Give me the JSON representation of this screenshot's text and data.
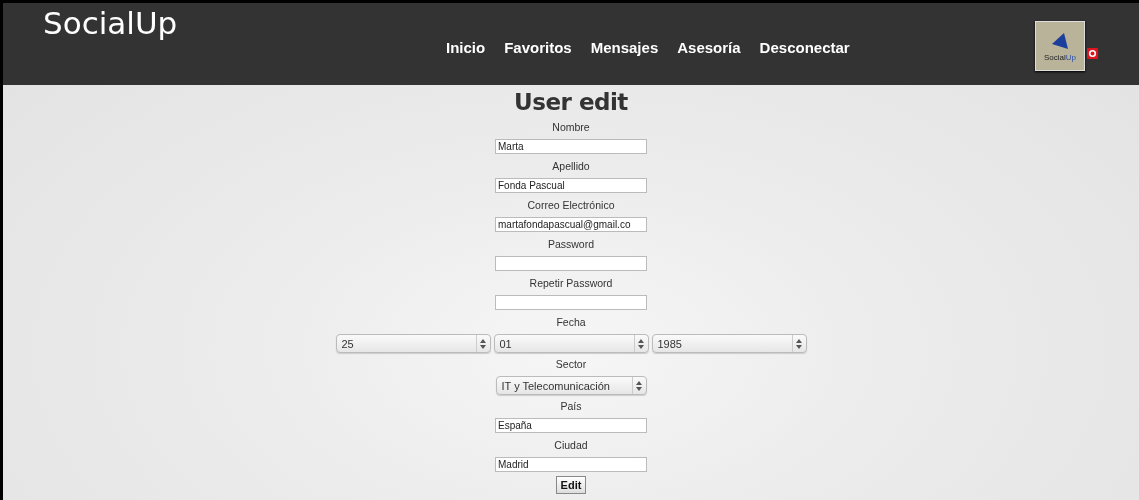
{
  "brand": "SocialUp",
  "nav": [
    {
      "label": "Inicio"
    },
    {
      "label": "Favoritos"
    },
    {
      "label": "Mensajes"
    },
    {
      "label": "Asesoría"
    },
    {
      "label": "Desconectar"
    }
  ],
  "avatar": {
    "text_left": "Social",
    "text_right": "Up"
  },
  "form": {
    "title": "User edit",
    "fields": [
      {
        "kind": "text",
        "label": "Nombre",
        "value": "Marta"
      },
      {
        "kind": "text",
        "label": "Apellido",
        "value": "Fonda Pascual"
      },
      {
        "kind": "text",
        "label": "Correo Electrónico",
        "value": "martafondapascual@gmail.co"
      },
      {
        "kind": "text",
        "label": "Password"
      },
      {
        "kind": "text",
        "label": "Repetir Password"
      },
      {
        "kind": "date",
        "label": "Fecha",
        "values": [
          "25",
          "01",
          "1985"
        ]
      },
      {
        "kind": "select",
        "label": "Sector",
        "value": "IT y Telecomunicación"
      },
      {
        "kind": "text",
        "label": "País",
        "value": "España"
      },
      {
        "kind": "text",
        "label": "Ciudad",
        "value": "Madrid"
      }
    ],
    "submit": "Edit"
  }
}
